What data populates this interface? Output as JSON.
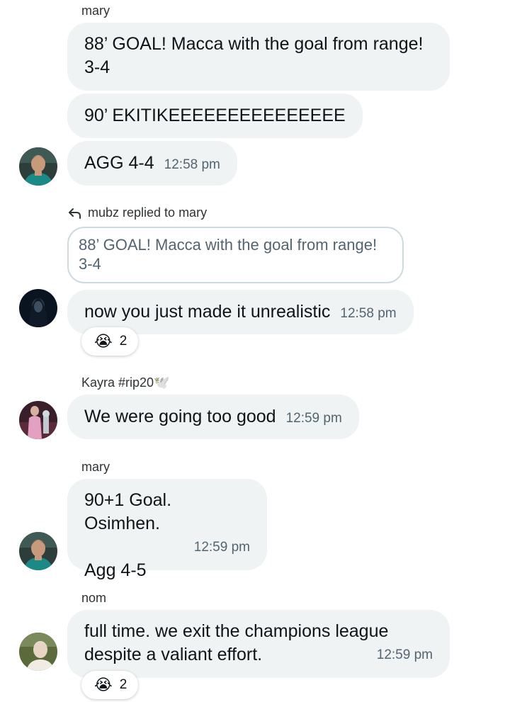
{
  "messages": [
    {
      "sender": "mary",
      "text": "88’ GOAL! Macca with the goal from range! 3-4"
    },
    {
      "text": "90’ EKITIKEEEEEEEEEEEEEEE"
    },
    {
      "text": "AGG 4-4",
      "time": "12:58 pm"
    },
    {
      "reply_header": "mubz replied to mary",
      "quote": "88’ GOAL! Macca with the goal from range! 3-4",
      "text": "now you just made it unrealistic",
      "time": "12:58 pm",
      "reaction": {
        "emoji": "😭",
        "count": "2"
      }
    },
    {
      "sender": "Kayra #rip20🕊️",
      "text": "We were going too good",
      "time": "12:59 pm"
    },
    {
      "sender": "mary",
      "line1": "90+1 Goal. Osimhen.",
      "line2": "Agg 4-5",
      "time": "12:59 pm"
    },
    {
      "sender": "nom",
      "line1": "full time. we exit the champions league",
      "line2": "despite a valiant effort.",
      "time": "12:59 pm",
      "reaction": {
        "emoji": "😭",
        "count": "2"
      }
    }
  ],
  "icons": {
    "reply": "reply-arrow-icon",
    "avatars": [
      "avatar-mary",
      "avatar-mubz",
      "avatar-kayra",
      "avatar-mary",
      "avatar-nom"
    ]
  },
  "colors": {
    "bubble": "#eff3f4",
    "text": "#0f1419",
    "secondary": "#536471",
    "quote_border": "#cfd9de"
  }
}
